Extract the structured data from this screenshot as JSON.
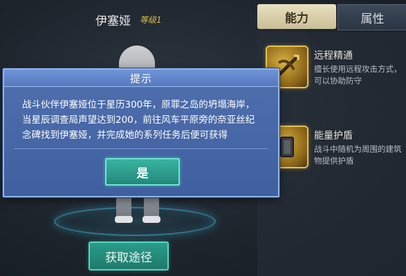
{
  "character": {
    "name": "伊塞娅",
    "level": "等级1"
  },
  "tabs": {
    "ability": "能力",
    "attributes": "属性"
  },
  "skills": [
    {
      "icon": "crossbow-icon",
      "title": "远程精通",
      "desc": "擅长使用远程攻击方式，可以协助防守"
    },
    {
      "icon": "tower-shield-icon",
      "title": "能量护盾",
      "desc": "战斗中随机为周围的建筑物提供护盾"
    }
  ],
  "dialog": {
    "title": "提示",
    "message": "战斗伙伴伊塞娅位于星历300年，原罪之岛的坍塌海岸，\n当星辰调查局声望达到200，前往风车平原旁的奈亚丝纪\n念碑找到伊塞娅，并完成她的系列任务后便可获得",
    "confirm": "是"
  },
  "obtain_button": "获取途径",
  "colors": {
    "accent_teal": "#2a9c8a",
    "dialog_blue": "#4f6fae",
    "skill_gold": "#d9b240"
  }
}
